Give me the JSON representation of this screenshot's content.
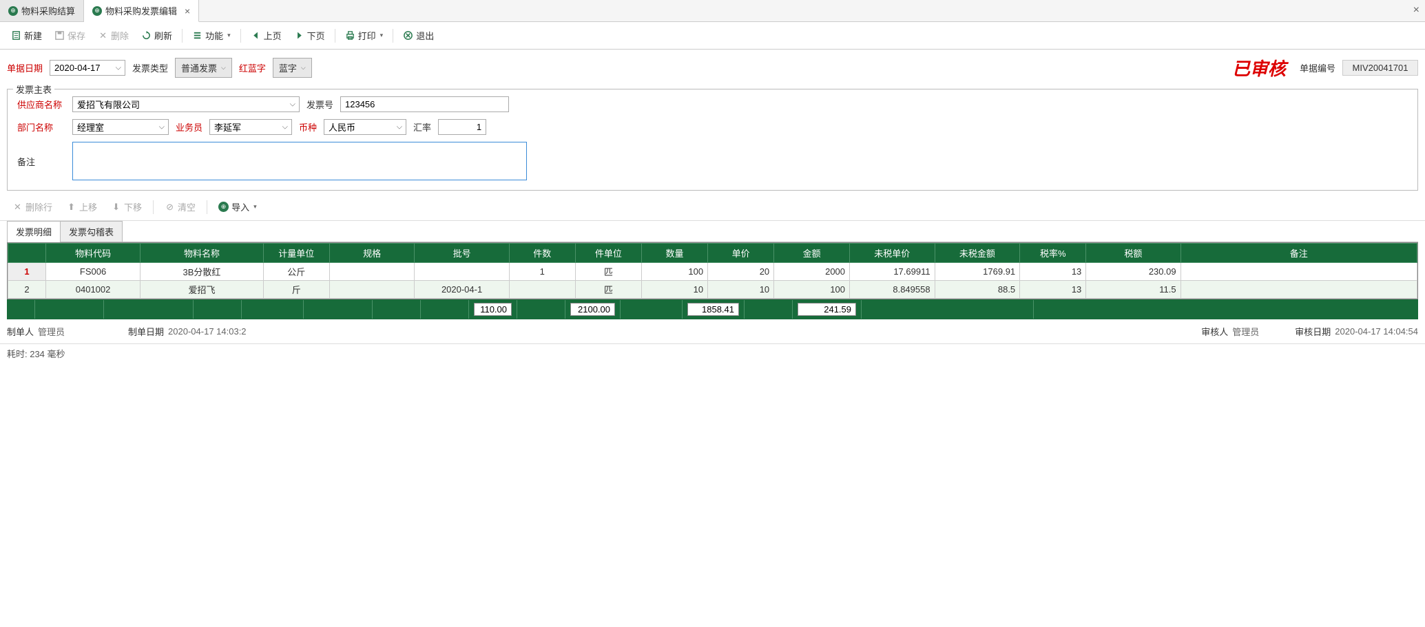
{
  "tabs": [
    {
      "label": "物料采购结算",
      "active": false
    },
    {
      "label": "物料采购发票编辑",
      "active": true
    }
  ],
  "toolbar": {
    "new": "新建",
    "save": "保存",
    "delete": "删除",
    "refresh": "刷新",
    "function": "功能",
    "prev": "上页",
    "next": "下页",
    "print": "打印",
    "exit": "退出"
  },
  "filters": {
    "doc_date_label": "单据日期",
    "doc_date": "2020-04-17",
    "inv_type_label": "发票类型",
    "inv_type": "普通发票",
    "red_blue_label": "红蓝字",
    "red_blue": "蓝字",
    "stamp": "已审核",
    "doc_no_label": "单据编号",
    "doc_no": "MIV20041701"
  },
  "master": {
    "legend": "发票主表",
    "supplier_label": "供应商名称",
    "supplier": "爱招飞有限公司",
    "inv_no_label": "发票号",
    "inv_no": "123456",
    "dept_label": "部门名称",
    "dept": "经理室",
    "salesman_label": "业务员",
    "salesman": "李延军",
    "currency_label": "币种",
    "currency": "人民币",
    "rate_label": "汇率",
    "rate": "1",
    "remark_label": "备注",
    "remark": ""
  },
  "sub_tb": {
    "delrow": "删除行",
    "up": "上移",
    "down": "下移",
    "clear": "清空",
    "import": "导入"
  },
  "sub_tabs": {
    "t1": "发票明细",
    "t2": "发票勾稽表"
  },
  "grid": {
    "cols": [
      "",
      "物料代码",
      "物料名称",
      "计量单位",
      "规格",
      "批号",
      "件数",
      "件单位",
      "数量",
      "单价",
      "金额",
      "未税单价",
      "未税金额",
      "税率%",
      "税额",
      "备注"
    ],
    "widths": [
      40,
      100,
      130,
      70,
      90,
      100,
      70,
      70,
      70,
      70,
      80,
      90,
      90,
      70,
      100,
      250
    ],
    "rows": [
      {
        "n": "1",
        "code": "FS006",
        "name": "3B分散红",
        "unit": "公斤",
        "spec": "",
        "lot": "",
        "pcs": "1",
        "punit": "匹",
        "qty": "100",
        "price": "20",
        "amt": "2000",
        "ntprice": "17.69911",
        "ntamt": "1769.91",
        "taxr": "13",
        "tax": "230.09",
        "remark": ""
      },
      {
        "n": "2",
        "code": "0401002",
        "name": "爱招飞",
        "unit": "斤",
        "spec": "",
        "lot": "2020-04-1",
        "pcs": "",
        "punit": "匹",
        "qty": "10",
        "price": "10",
        "amt": "100",
        "ntprice": "8.849558",
        "ntamt": "88.5",
        "taxr": "13",
        "tax": "11.5",
        "remark": ""
      }
    ],
    "totals": {
      "qty": "110.00",
      "amt": "2100.00",
      "ntamt": "1858.41",
      "tax": "241.59"
    }
  },
  "footer": {
    "maker_label": "制单人",
    "maker": "管理员",
    "make_date_label": "制单日期",
    "make_date": "2020-04-17 14:03:2",
    "auditor_label": "审核人",
    "auditor": "管理员",
    "audit_date_label": "审核日期",
    "audit_date": "2020-04-17 14:04:54"
  },
  "status": "耗时: 234 毫秒"
}
